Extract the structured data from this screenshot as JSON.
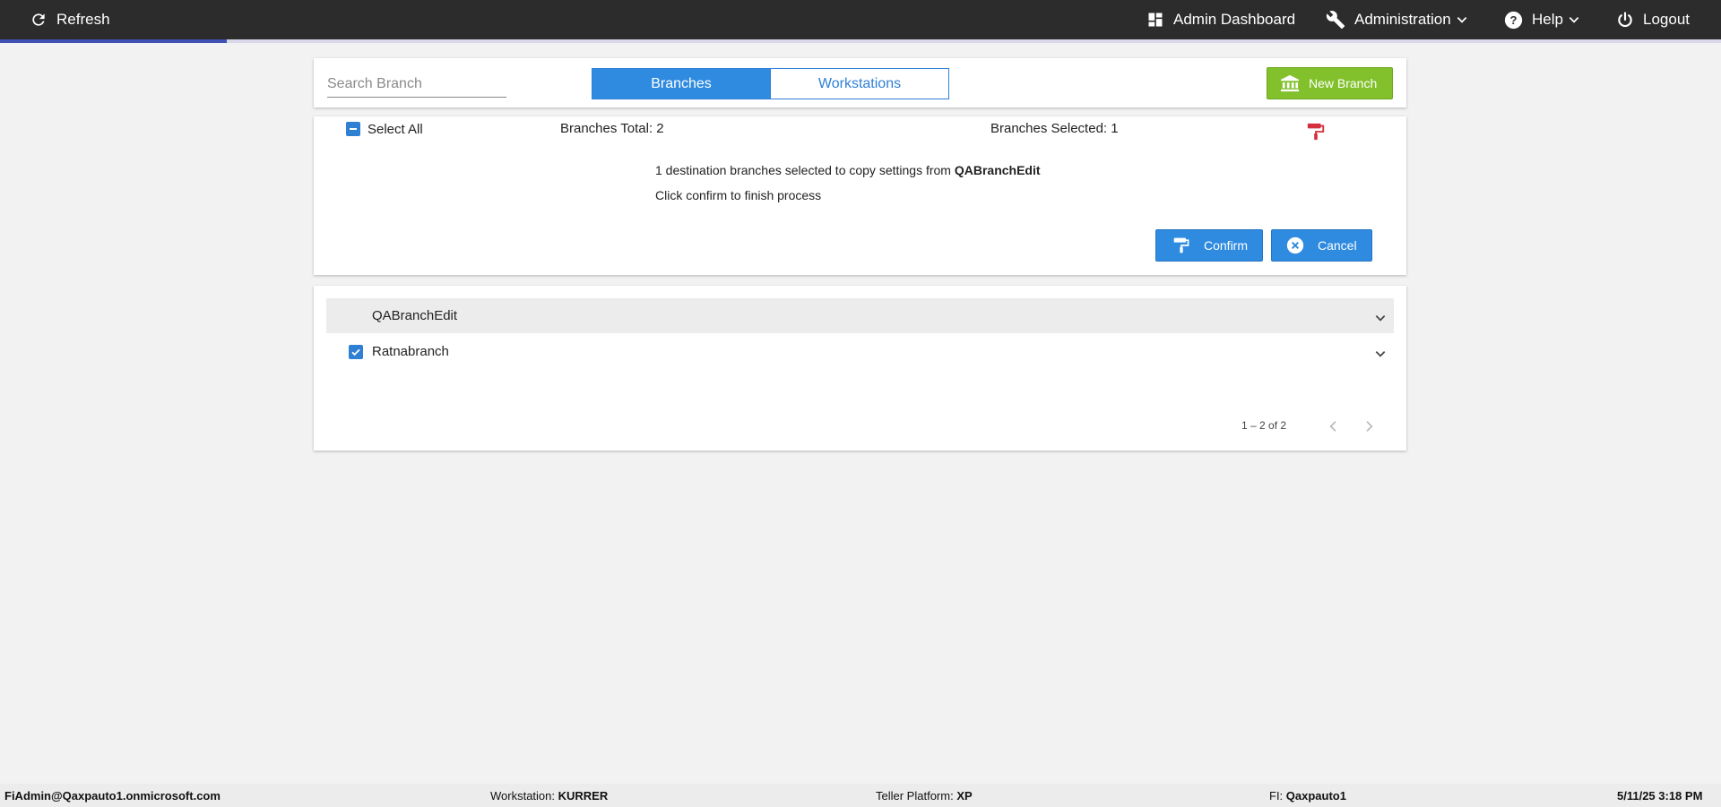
{
  "topbar": {
    "refresh_label": "Refresh",
    "admin_dashboard_label": "Admin Dashboard",
    "administration_label": "Administration",
    "help_label": "Help",
    "logout_label": "Logout"
  },
  "toolbar": {
    "search_placeholder": "Search Branch",
    "tabs": [
      {
        "label": "Branches",
        "active": true
      },
      {
        "label": "Workstations",
        "active": false
      }
    ],
    "new_branch_label": "New Branch"
  },
  "selection": {
    "select_all_label": "Select All",
    "branches_total": "Branches Total: 2",
    "branches_selected": "Branches Selected: 1",
    "message_prefix": "1 destination branches selected to copy settings from ",
    "message_source": "QABranchEdit",
    "message_line2": "Click confirm to finish process",
    "confirm_label": "Confirm",
    "cancel_label": "Cancel"
  },
  "branches": {
    "rows": [
      {
        "name": "QABranchEdit",
        "checked": false,
        "source": true
      },
      {
        "name": "Ratnabranch",
        "checked": true,
        "source": false
      }
    ],
    "pagination": "1 – 2 of 2"
  },
  "footer": {
    "user": "FiAdmin@Qaxpauto1.onmicrosoft.com",
    "workstation_label": "Workstation: ",
    "workstation_value": "KURRER",
    "platform_label": "Teller Platform: ",
    "platform_value": "XP",
    "fi_label": "FI: ",
    "fi_value": "Qaxpauto1",
    "datetime": "5/11/25 3:18 PM"
  },
  "colors": {
    "topbar": "#2c2c2c",
    "accent_blue": "#2f8be0",
    "green": "#82c12c",
    "paint_icon_red": "#d32f3f"
  }
}
